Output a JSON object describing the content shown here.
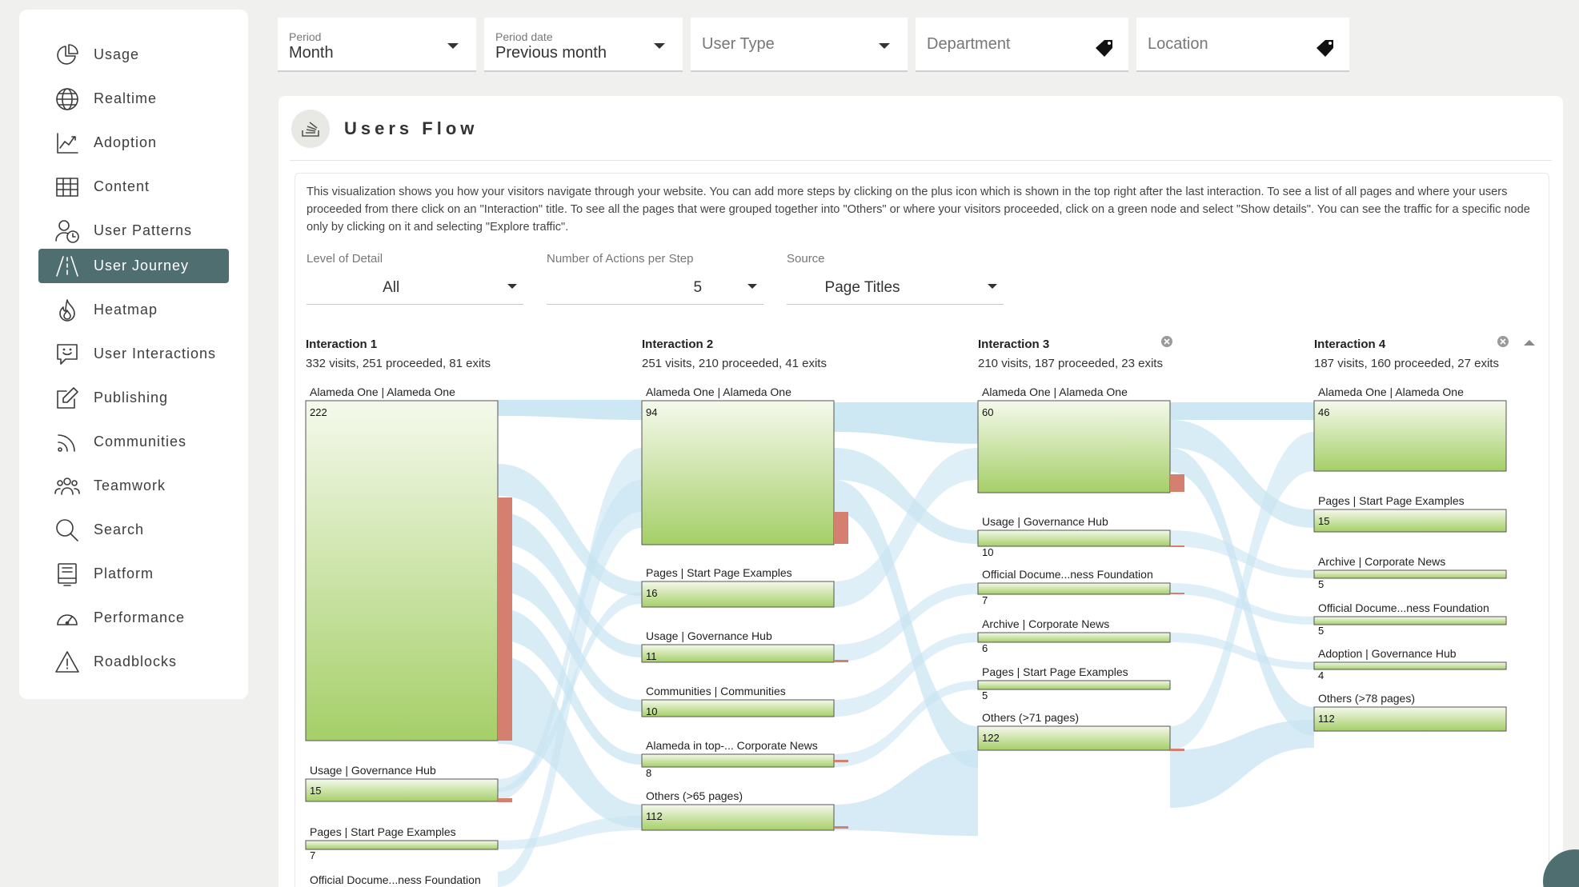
{
  "sidebar": {
    "items": [
      {
        "label": "Usage",
        "icon": "pie-chart-icon"
      },
      {
        "label": "Realtime",
        "icon": "globe-icon"
      },
      {
        "label": "Adoption",
        "icon": "trend-chart-icon"
      },
      {
        "label": "Content",
        "icon": "table-grid-icon"
      },
      {
        "label": "User Patterns",
        "icon": "user-clock-icon"
      },
      {
        "label": "User Journey",
        "icon": "road-icon",
        "active": true
      },
      {
        "label": "Heatmap",
        "icon": "flame-icon"
      },
      {
        "label": "User Interactions",
        "icon": "chat-smile-icon"
      },
      {
        "label": "Publishing",
        "icon": "edit-icon"
      },
      {
        "label": "Communities",
        "icon": "rss-icon"
      },
      {
        "label": "Teamwork",
        "icon": "users-group-icon"
      },
      {
        "label": "Search",
        "icon": "search-icon"
      },
      {
        "label": "Platform",
        "icon": "monitor-icon"
      },
      {
        "label": "Performance",
        "icon": "gauge-icon"
      },
      {
        "label": "Roadblocks",
        "icon": "warning-icon"
      }
    ]
  },
  "filters": {
    "period": {
      "label": "Period",
      "value": "Month"
    },
    "period_date": {
      "label": "Period date",
      "value": "Previous month"
    },
    "user_type": {
      "placeholder": "User Type"
    },
    "department": {
      "placeholder": "Department"
    },
    "location": {
      "placeholder": "Location"
    }
  },
  "panel": {
    "title": "Users Flow",
    "description": "This visualization shows you how your visitors navigate through your website. You can add more steps by clicking on the plus icon which is shown in the top right after the last interaction. To see a list of all pages and where your users proceeded from there click on an \"Interaction\" title. To see all the pages that were grouped together into \"Others\" or where your visitors proceeded, click on a green node and select \"Show details\". You can see the traffic for a specific node only by clicking on it and selecting \"Explore traffic\".",
    "level_of_detail": {
      "label": "Level of Detail",
      "value": "All"
    },
    "actions_per_step": {
      "label": "Number of Actions per Step",
      "value": "5"
    },
    "source": {
      "label": "Source",
      "value": "Page Titles"
    }
  },
  "colors": {
    "accent": "#4f6e70",
    "link": "#c8e4f2",
    "node_top": "#f4f9ea",
    "node_bottom": "#a6cf6a",
    "exit": "#d47f6f"
  },
  "interactions": [
    {
      "title": "Interaction 1",
      "stats": "332 visits, 251 proceeded, 81 exits",
      "nodes": [
        {
          "label": "Alameda One | Alameda One",
          "value": "222"
        },
        {
          "label": "Usage | Governance Hub",
          "value": "15"
        },
        {
          "label": "Pages | Start Page Examples",
          "value": "7"
        },
        {
          "label": "Official Docume...ness Foundation",
          "value": ""
        }
      ]
    },
    {
      "title": "Interaction 2",
      "stats": "251 visits, 210 proceeded, 41 exits",
      "nodes": [
        {
          "label": "Alameda One | Alameda One",
          "value": "94"
        },
        {
          "label": "Pages | Start Page Examples",
          "value": "16"
        },
        {
          "label": "Usage | Governance Hub",
          "value": "11"
        },
        {
          "label": "Communities | Communities",
          "value": "10"
        },
        {
          "label": "Alameda in top-... Corporate News",
          "value": "8"
        },
        {
          "label": "Others (>65 pages)",
          "value": "112"
        }
      ]
    },
    {
      "title": "Interaction 3",
      "stats": "210 visits, 187 proceeded, 23 exits",
      "nodes": [
        {
          "label": "Alameda One | Alameda One",
          "value": "60"
        },
        {
          "label": "Usage | Governance Hub",
          "value": "10"
        },
        {
          "label": "Official Docume...ness Foundation",
          "value": "7"
        },
        {
          "label": "Archive | Corporate News",
          "value": "6"
        },
        {
          "label": "Pages | Start Page Examples",
          "value": "5"
        },
        {
          "label": "Others (>71 pages)",
          "value": "122"
        }
      ]
    },
    {
      "title": "Interaction 4",
      "stats": "187 visits, 160 proceeded, 27 exits",
      "nodes": [
        {
          "label": "Alameda One | Alameda One",
          "value": "46"
        },
        {
          "label": "Pages | Start Page Examples",
          "value": "15"
        },
        {
          "label": "Archive | Corporate News",
          "value": "5"
        },
        {
          "label": "Official Docume...ness Foundation",
          "value": "5"
        },
        {
          "label": "Adoption | Governance Hub",
          "value": "4"
        },
        {
          "label": "Others (>78 pages)",
          "value": "112"
        }
      ]
    }
  ]
}
